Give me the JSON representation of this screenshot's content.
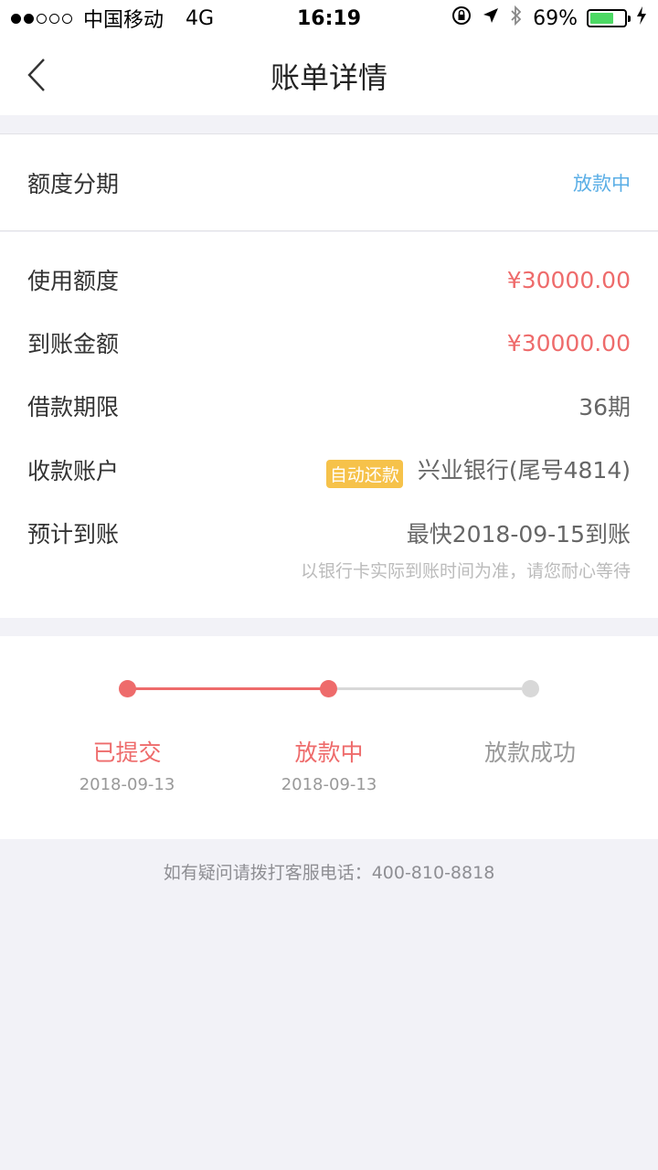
{
  "status_bar": {
    "carrier": "中国移动",
    "network": "4G",
    "time": "16:19",
    "battery": "69%",
    "battery_level": 0.69
  },
  "nav": {
    "title": "账单详情"
  },
  "bill": {
    "type_label": "额度分期",
    "status": "放款中",
    "rows": [
      {
        "label": "使用额度",
        "value": "¥30000.00"
      },
      {
        "label": "到账金额",
        "value": "¥30000.00"
      },
      {
        "label": "借款期限",
        "value": "36期"
      },
      {
        "label": "收款账户",
        "badge": "自动还款",
        "value": "兴业银行(尾号4814)"
      },
      {
        "label": "预计到账",
        "value": "最快2018-09-15到账"
      }
    ],
    "arrival_note": "以银行卡实际到账时间为准，请您耐心等待"
  },
  "progress": {
    "steps": [
      {
        "label": "已提交",
        "date": "2018-09-13"
      },
      {
        "label": "放款中",
        "date": "2018-09-13"
      },
      {
        "label": "放款成功",
        "date": ""
      }
    ],
    "active_color": "#ee6b6b",
    "inactive_color": "#d8d8d8"
  },
  "footer": {
    "text": "如有疑问请拨打客服电话：400-810-8818"
  }
}
